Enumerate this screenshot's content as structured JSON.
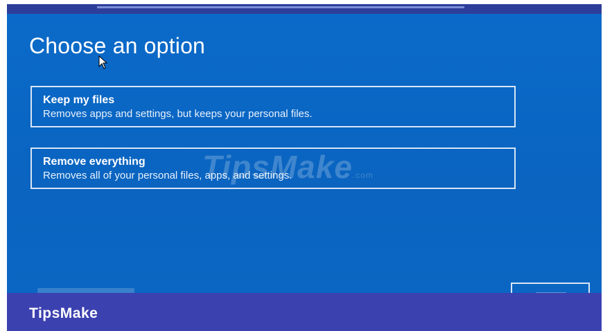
{
  "screen": {
    "title": "Choose an option"
  },
  "options": [
    {
      "title": "Keep my files",
      "description": "Removes apps and settings, but keeps your personal files."
    },
    {
      "title": "Remove everything",
      "description": "Removes all of your personal files, apps, and settings."
    }
  ],
  "watermark": {
    "text": "TipsMake",
    "suffix": ".com"
  },
  "brand_bar": {
    "text": "TipsMake"
  },
  "colors": {
    "screen_background": "#0a66c2",
    "brand_bar": "#3c41b0",
    "option_border": "#d8e6f6"
  }
}
